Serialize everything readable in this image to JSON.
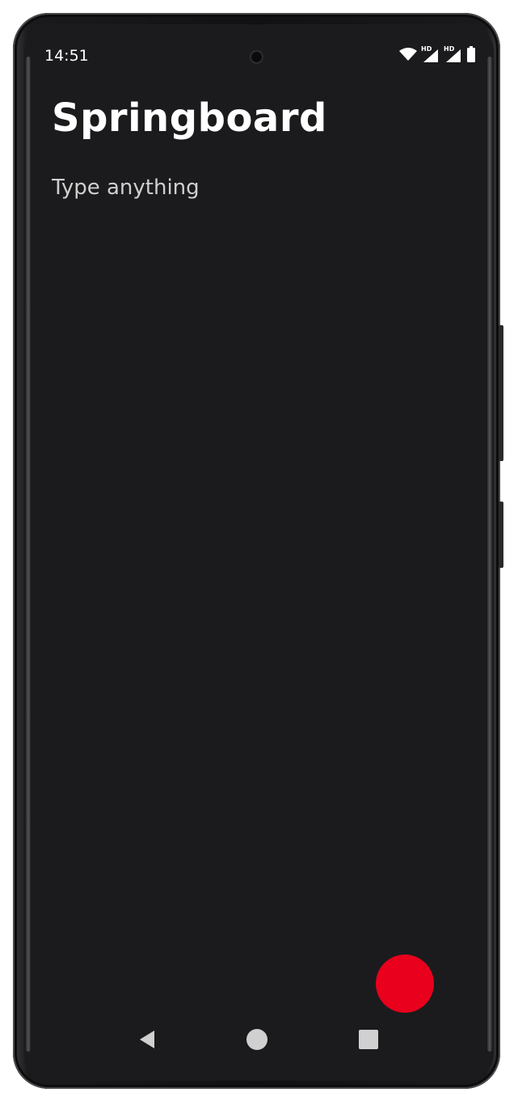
{
  "status_bar": {
    "time": "14:51",
    "icons": [
      "wifi-icon",
      "signal-hd-icon",
      "signal-hd-icon",
      "battery-icon"
    ],
    "hd_label": "HD"
  },
  "app": {
    "title": "Springboard"
  },
  "input": {
    "placeholder": "Type anything",
    "value": ""
  },
  "fab": {
    "color": "#e8001c"
  },
  "nav_bar": {
    "icons": [
      "back-icon",
      "home-icon",
      "recents-icon"
    ]
  },
  "colors": {
    "background": "#1b1b1d",
    "text": "#ffffff",
    "accent": "#e8001c"
  }
}
